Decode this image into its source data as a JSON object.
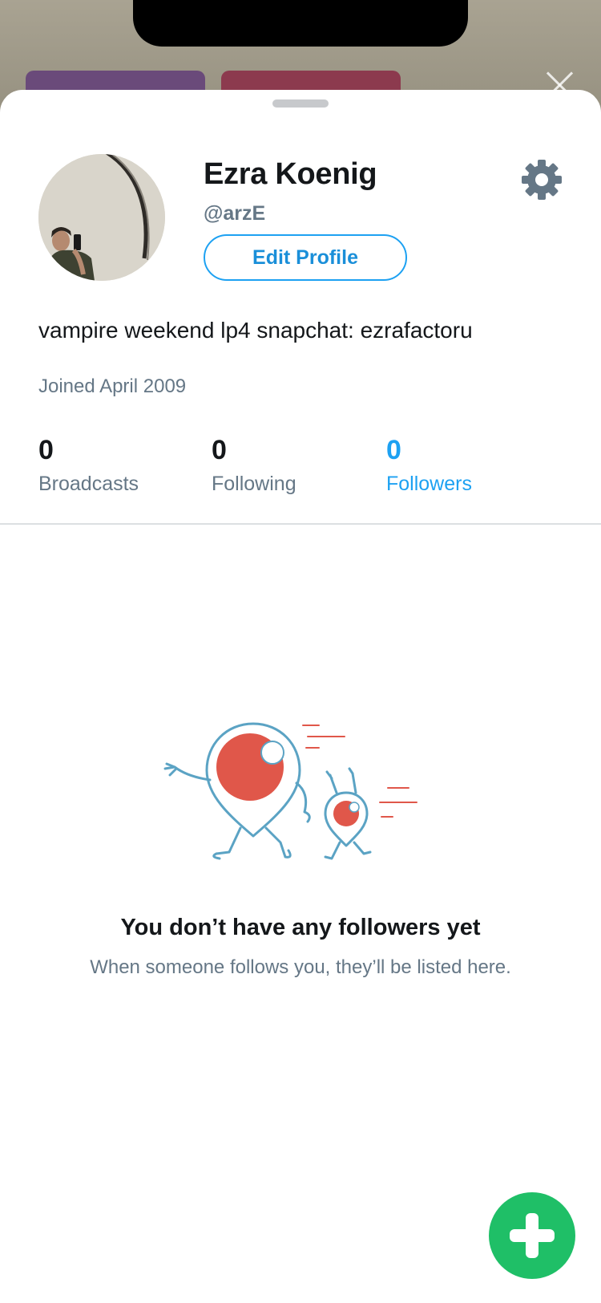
{
  "profile": {
    "name": "Ezra Koenig",
    "handle": "@arzE",
    "edit_label": "Edit Profile",
    "bio": "vampire weekend lp4 snapchat: ezrafactoru",
    "joined": "Joined April 2009"
  },
  "stats": [
    {
      "count": "0",
      "label": "Broadcasts"
    },
    {
      "count": "0",
      "label": "Following"
    },
    {
      "count": "0",
      "label": "Followers",
      "active": true
    }
  ],
  "empty_state": {
    "title": "You don’t have any followers yet",
    "subtitle": "When someone follows you, they’ll be listed here."
  },
  "icons": {
    "settings": "gear-icon",
    "add": "plus-icon",
    "close": "close-icon"
  },
  "colors": {
    "accent": "#1da1f2",
    "fab": "#1fbf67",
    "text": "#14171a",
    "muted": "#657786",
    "illustration_red": "#e0574a",
    "illustration_blue": "#5ba3c4"
  }
}
